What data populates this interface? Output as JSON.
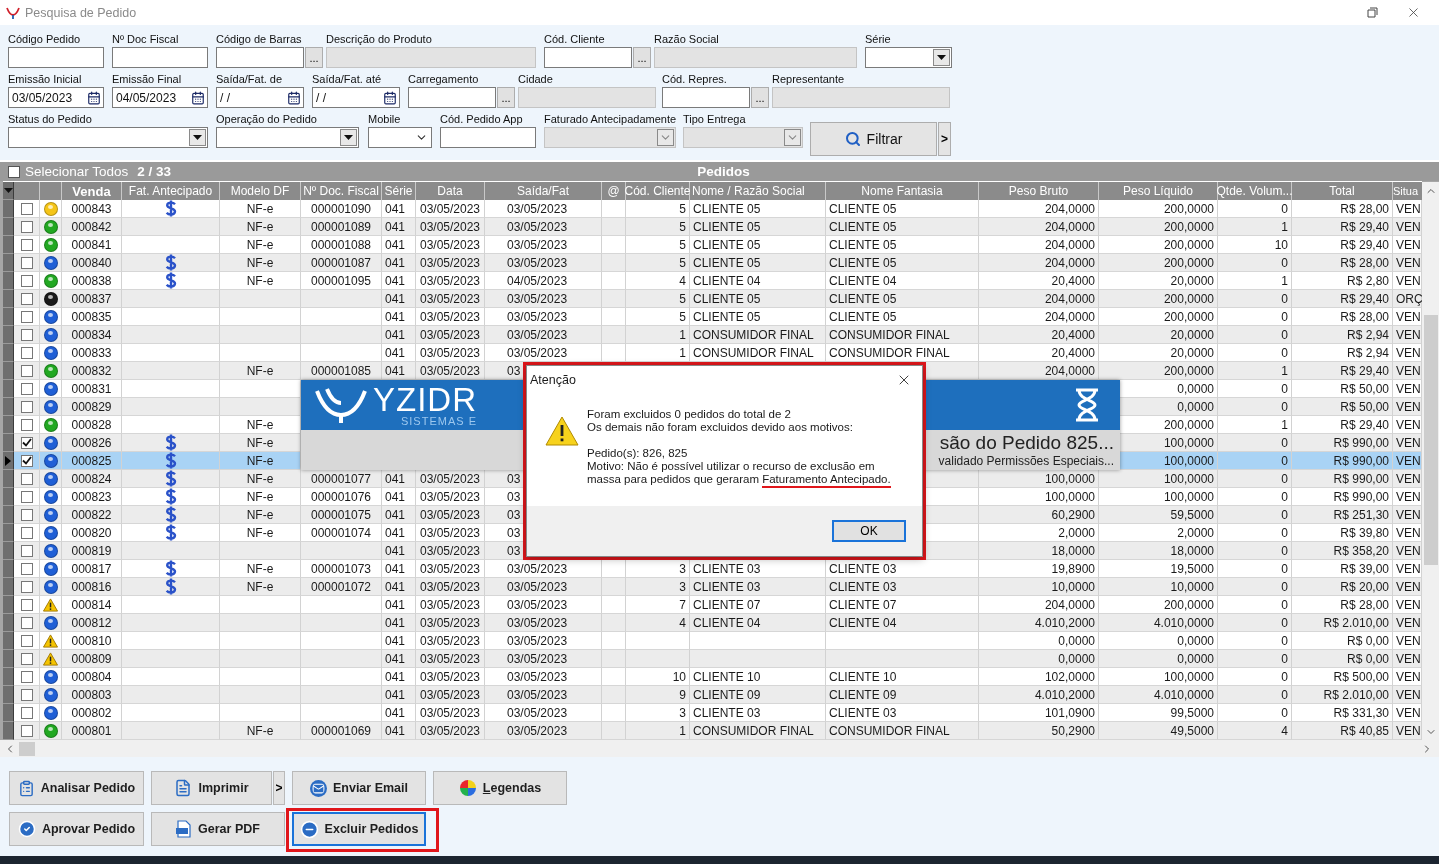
{
  "window": {
    "title": "Pesquisa de Pedido"
  },
  "filter_rows": [
    {
      "fields": [
        {
          "label": "Código Pedido",
          "kind": "text",
          "disabled": false
        },
        {
          "label": "Nº Doc Fiscal",
          "kind": "text",
          "disabled": false
        },
        {
          "label": "Código de Barras",
          "kind": "lookup",
          "button": "...",
          "disabled": false
        },
        {
          "label": "Descrição do Produto",
          "kind": "text",
          "disabled": true
        },
        {
          "label": "Cód. Cliente",
          "kind": "lookup",
          "button": "...",
          "disabled": false
        },
        {
          "label": "Razão Social",
          "kind": "text",
          "disabled": true
        },
        {
          "label": "Série",
          "kind": "select",
          "disabled": false
        }
      ]
    },
    {
      "fields": [
        {
          "label": "Emissão Inicial",
          "kind": "date",
          "value": "03/05/2023",
          "disabled": false
        },
        {
          "label": "Emissão Final",
          "kind": "date",
          "value": "04/05/2023",
          "disabled": false
        },
        {
          "label": "Saída/Fat. de",
          "kind": "date",
          "value": "/ /",
          "disabled": false
        },
        {
          "label": "Saída/Fat. até",
          "kind": "date",
          "value": "/ /",
          "disabled": false
        },
        {
          "label": "Carregamento",
          "kind": "lookup",
          "button": "...",
          "disabled": false
        },
        {
          "label": "Cidade",
          "kind": "text",
          "disabled": true
        },
        {
          "label": "Cód. Repres.",
          "kind": "lookup",
          "button": "...",
          "disabled": false
        },
        {
          "label": "Representante",
          "kind": "text",
          "disabled": true
        }
      ]
    },
    {
      "fields": [
        {
          "label": "Status do Pedido",
          "kind": "select",
          "disabled": false
        },
        {
          "label": "Operação do Pedido",
          "kind": "select",
          "disabled": false
        },
        {
          "label": "Mobile",
          "kind": "combo",
          "disabled": false
        },
        {
          "label": "Cód. Pedido App",
          "kind": "text",
          "disabled": false
        },
        {
          "label": "Faturado Antecipadamente",
          "kind": "combo",
          "disabled": true
        },
        {
          "label": "Tipo Entrega",
          "kind": "combo",
          "disabled": true
        }
      ]
    }
  ],
  "filter_button": {
    "label": "Filtrar",
    "more": ">"
  },
  "grid": {
    "select_all": {
      "label": "Selecionar Todos",
      "checked": false
    },
    "count": "2 / 33",
    "title": "Pedidos",
    "columns": [
      "Venda",
      "Fat. Antecipado",
      "Modelo DF",
      "Nº Doc. Fiscal",
      "Série",
      "Data",
      "Saída/Fat",
      "@",
      "Cód. Cliente",
      "Nome / Razão Social",
      "Nome Fantasia",
      "Peso Bruto",
      "Peso Líquido",
      "Qtde. Volum...",
      "Total",
      "Situa"
    ],
    "rows": [
      {
        "status": {
          "kind": "dot",
          "color": "#f5c518"
        },
        "checked": false,
        "selected": false,
        "fat_antecipado": true,
        "cells": {
          "venda": "000843",
          "modelo": "NF-e",
          "doc": "000001090",
          "serie": "041",
          "data": "03/05/2023",
          "saida": "03/05/2023",
          "cliente": "5",
          "nome": "CLIENTE 05",
          "fantasia": "CLIENTE 05",
          "bruto": "204,0000",
          "liquido": "200,0000",
          "volumes": "0",
          "total": "R$ 28,00",
          "situacao": "VEN"
        }
      },
      {
        "status": {
          "kind": "dot",
          "color": "#22a822"
        },
        "checked": false,
        "selected": false,
        "fat_antecipado": false,
        "cells": {
          "venda": "000842",
          "modelo": "NF-e",
          "doc": "000001089",
          "serie": "041",
          "data": "03/05/2023",
          "saida": "03/05/2023",
          "cliente": "5",
          "nome": "CLIENTE 05",
          "fantasia": "CLIENTE 05",
          "bruto": "204,0000",
          "liquido": "200,0000",
          "volumes": "1",
          "total": "R$ 29,40",
          "situacao": "VEN"
        }
      },
      {
        "status": {
          "kind": "dot",
          "color": "#22a822"
        },
        "checked": false,
        "selected": false,
        "fat_antecipado": false,
        "cells": {
          "venda": "000841",
          "modelo": "NF-e",
          "doc": "000001088",
          "serie": "041",
          "data": "03/05/2023",
          "saida": "03/05/2023",
          "cliente": "5",
          "nome": "CLIENTE 05",
          "fantasia": "CLIENTE 05",
          "bruto": "204,0000",
          "liquido": "200,0000",
          "volumes": "10",
          "total": "R$ 29,40",
          "situacao": "VEN"
        }
      },
      {
        "status": {
          "kind": "dot",
          "color": "#1f5fd6"
        },
        "checked": false,
        "selected": false,
        "fat_antecipado": true,
        "cells": {
          "venda": "000840",
          "modelo": "NF-e",
          "doc": "000001087",
          "serie": "041",
          "data": "03/05/2023",
          "saida": "03/05/2023",
          "cliente": "5",
          "nome": "CLIENTE 05",
          "fantasia": "CLIENTE 05",
          "bruto": "204,0000",
          "liquido": "200,0000",
          "volumes": "0",
          "total": "R$ 28,00",
          "situacao": "VEN"
        }
      },
      {
        "status": {
          "kind": "dot",
          "color": "#22a822"
        },
        "checked": false,
        "selected": false,
        "fat_antecipado": true,
        "cells": {
          "venda": "000838",
          "modelo": "NF-e",
          "doc": "000001095",
          "serie": "041",
          "data": "03/05/2023",
          "saida": "04/05/2023",
          "cliente": "4",
          "nome": "CLIENTE 04",
          "fantasia": "CLIENTE 04",
          "bruto": "20,4000",
          "liquido": "20,0000",
          "volumes": "1",
          "total": "R$ 2,80",
          "situacao": "VEN"
        }
      },
      {
        "status": {
          "kind": "dot",
          "color": "#1a1a1a"
        },
        "checked": false,
        "selected": false,
        "fat_antecipado": false,
        "cells": {
          "venda": "000837",
          "serie": "041",
          "data": "03/05/2023",
          "saida": "03/05/2023",
          "cliente": "5",
          "nome": "CLIENTE 05",
          "fantasia": "CLIENTE 05",
          "bruto": "204,0000",
          "liquido": "200,0000",
          "volumes": "0",
          "total": "R$ 29,40",
          "situacao": "ORÇ"
        }
      },
      {
        "status": {
          "kind": "dot",
          "color": "#1f5fd6"
        },
        "checked": false,
        "selected": false,
        "fat_antecipado": false,
        "cells": {
          "venda": "000835",
          "serie": "041",
          "data": "03/05/2023",
          "saida": "03/05/2023",
          "cliente": "5",
          "nome": "CLIENTE 05",
          "fantasia": "CLIENTE 05",
          "bruto": "204,0000",
          "liquido": "200,0000",
          "volumes": "0",
          "total": "R$ 28,00",
          "situacao": "VEN"
        }
      },
      {
        "status": {
          "kind": "dot",
          "color": "#1f5fd6"
        },
        "checked": false,
        "selected": false,
        "fat_antecipado": false,
        "cells": {
          "venda": "000834",
          "serie": "041",
          "data": "03/05/2023",
          "saida": "03/05/2023",
          "cliente": "1",
          "nome": "CONSUMIDOR FINAL",
          "fantasia": "CONSUMIDOR FINAL",
          "bruto": "20,4000",
          "liquido": "20,0000",
          "volumes": "0",
          "total": "R$ 2,94",
          "situacao": "VEN"
        }
      },
      {
        "status": {
          "kind": "dot",
          "color": "#1f5fd6"
        },
        "checked": false,
        "selected": false,
        "fat_antecipado": false,
        "cells": {
          "venda": "000833",
          "serie": "041",
          "data": "03/05/2023",
          "saida": "03/05/2023",
          "cliente": "1",
          "nome": "CONSUMIDOR FINAL",
          "fantasia": "CONSUMIDOR FINAL",
          "bruto": "20,4000",
          "liquido": "20,0000",
          "volumes": "0",
          "total": "R$ 2,94",
          "situacao": "VEN"
        }
      },
      {
        "status": {
          "kind": "dot",
          "color": "#22a822"
        },
        "checked": false,
        "selected": false,
        "fat_antecipado": false,
        "cells": {
          "venda": "000832",
          "modelo": "NF-e",
          "doc": "000001085",
          "serie": "041",
          "data": "03/05/2023",
          "saida": "03",
          "bruto": "204,0000",
          "liquido": "200,0000",
          "volumes": "1",
          "total": "R$ 29,40",
          "situacao": "VEN"
        }
      },
      {
        "status": {
          "kind": "dot",
          "color": "#1f5fd6"
        },
        "checked": false,
        "selected": false,
        "fat_antecipado": false,
        "cells": {
          "venda": "000831",
          "liquido": "0,0000",
          "volumes": "0",
          "total": "R$ 50,00",
          "situacao": "VEN"
        }
      },
      {
        "status": {
          "kind": "dot",
          "color": "#1f5fd6"
        },
        "checked": false,
        "selected": false,
        "fat_antecipado": false,
        "cells": {
          "venda": "000829",
          "liquido": "0,0000",
          "volumes": "0",
          "total": "R$ 50,00",
          "situacao": "VEN"
        }
      },
      {
        "status": {
          "kind": "dot",
          "color": "#22a822"
        },
        "checked": false,
        "selected": false,
        "fat_antecipado": false,
        "cells": {
          "venda": "000828",
          "modelo": "NF-e",
          "liquido": "200,0000",
          "volumes": "1",
          "total": "R$ 29,40",
          "situacao": "VEN"
        }
      },
      {
        "status": {
          "kind": "dot",
          "color": "#1f5fd6"
        },
        "checked": true,
        "selected": false,
        "fat_antecipado": true,
        "cells": {
          "venda": "000826",
          "modelo": "NF-e",
          "liquido": "100,0000",
          "volumes": "0",
          "total": "R$ 990,00",
          "situacao": "VEN"
        }
      },
      {
        "status": {
          "kind": "dot",
          "color": "#1f5fd6"
        },
        "checked": true,
        "selected": true,
        "fat_antecipado": true,
        "cells": {
          "venda": "000825",
          "modelo": "NF-e",
          "liquido": "100,0000",
          "volumes": "0",
          "total": "R$ 990,00",
          "situacao": "VEN"
        }
      },
      {
        "status": {
          "kind": "dot",
          "color": "#1f5fd6"
        },
        "checked": false,
        "selected": false,
        "fat_antecipado": true,
        "cells": {
          "venda": "000824",
          "modelo": "NF-e",
          "doc": "000001077",
          "serie": "041",
          "data": "03/05/2023",
          "saida": "03",
          "bruto": "100,0000",
          "liquido": "100,0000",
          "volumes": "0",
          "total": "R$ 990,00",
          "situacao": "VEN"
        }
      },
      {
        "status": {
          "kind": "dot",
          "color": "#1f5fd6"
        },
        "checked": false,
        "selected": false,
        "fat_antecipado": true,
        "cells": {
          "venda": "000823",
          "modelo": "NF-e",
          "doc": "000001076",
          "serie": "041",
          "data": "03/05/2023",
          "saida": "03",
          "bruto": "100,0000",
          "liquido": "100,0000",
          "volumes": "0",
          "total": "R$ 990,00",
          "situacao": "VEN"
        }
      },
      {
        "status": {
          "kind": "dot",
          "color": "#1f5fd6"
        },
        "checked": false,
        "selected": false,
        "fat_antecipado": true,
        "cells": {
          "venda": "000822",
          "modelo": "NF-e",
          "doc": "000001075",
          "serie": "041",
          "data": "03/05/2023",
          "saida": "03",
          "bruto": "60,2900",
          "liquido": "59,5000",
          "volumes": "0",
          "total": "R$ 251,30",
          "situacao": "VEN"
        }
      },
      {
        "status": {
          "kind": "dot",
          "color": "#1f5fd6"
        },
        "checked": false,
        "selected": false,
        "fat_antecipado": true,
        "cells": {
          "venda": "000820",
          "modelo": "NF-e",
          "doc": "000001074",
          "serie": "041",
          "data": "03/05/2023",
          "saida": "03",
          "bruto": "2,0000",
          "liquido": "2,0000",
          "volumes": "0",
          "total": "R$ 39,80",
          "situacao": "VEN"
        }
      },
      {
        "status": {
          "kind": "dot",
          "color": "#1f5fd6"
        },
        "checked": false,
        "selected": false,
        "fat_antecipado": false,
        "cells": {
          "venda": "000819",
          "serie": "041",
          "data": "03/05/2023",
          "saida": "03",
          "bruto": "18,0000",
          "liquido": "18,0000",
          "volumes": "0",
          "total": "R$ 358,20",
          "situacao": "VEN"
        }
      },
      {
        "status": {
          "kind": "dot",
          "color": "#1f5fd6"
        },
        "checked": false,
        "selected": false,
        "fat_antecipado": true,
        "cells": {
          "venda": "000817",
          "modelo": "NF-e",
          "doc": "000001073",
          "serie": "041",
          "data": "03/05/2023",
          "saida": "03/05/2023",
          "cliente": "3",
          "nome": "CLIENTE 03",
          "fantasia": "CLIENTE 03",
          "bruto": "19,8900",
          "liquido": "19,5000",
          "volumes": "0",
          "total": "R$ 39,00",
          "situacao": "VEN"
        }
      },
      {
        "status": {
          "kind": "dot",
          "color": "#1f5fd6"
        },
        "checked": false,
        "selected": false,
        "fat_antecipado": true,
        "cells": {
          "venda": "000816",
          "modelo": "NF-e",
          "doc": "000001072",
          "serie": "041",
          "data": "03/05/2023",
          "saida": "03/05/2023",
          "cliente": "3",
          "nome": "CLIENTE 03",
          "fantasia": "CLIENTE 03",
          "bruto": "10,0000",
          "liquido": "10,0000",
          "volumes": "0",
          "total": "R$ 20,00",
          "situacao": "VEN"
        }
      },
      {
        "status": {
          "kind": "warning"
        },
        "checked": false,
        "selected": false,
        "fat_antecipado": false,
        "cells": {
          "venda": "000814",
          "serie": "041",
          "data": "03/05/2023",
          "saida": "03/05/2023",
          "cliente": "7",
          "nome": "CLIENTE 07",
          "fantasia": "CLIENTE 07",
          "bruto": "204,0000",
          "liquido": "200,0000",
          "volumes": "0",
          "total": "R$ 28,00",
          "situacao": "VEN"
        }
      },
      {
        "status": {
          "kind": "dot",
          "color": "#1f5fd6"
        },
        "checked": false,
        "selected": false,
        "fat_antecipado": false,
        "cells": {
          "venda": "000812",
          "serie": "041",
          "data": "03/05/2023",
          "saida": "03/05/2023",
          "cliente": "4",
          "nome": "CLIENTE 04",
          "fantasia": "CLIENTE 04",
          "bruto": "4.010,2000",
          "liquido": "4.010,0000",
          "volumes": "0",
          "total": "R$ 2.010,00",
          "situacao": "VEN"
        }
      },
      {
        "status": {
          "kind": "warning"
        },
        "checked": false,
        "selected": false,
        "fat_antecipado": false,
        "cells": {
          "venda": "000810",
          "serie": "041",
          "data": "03/05/2023",
          "saida": "03/05/2023",
          "bruto": "0,0000",
          "liquido": "0,0000",
          "volumes": "0",
          "total": "R$ 0,00",
          "situacao": "VEN"
        }
      },
      {
        "status": {
          "kind": "warning"
        },
        "checked": false,
        "selected": false,
        "fat_antecipado": false,
        "cells": {
          "venda": "000809",
          "serie": "041",
          "data": "03/05/2023",
          "saida": "03/05/2023",
          "bruto": "0,0000",
          "liquido": "0,0000",
          "volumes": "0",
          "total": "R$ 0,00",
          "situacao": "VEN"
        }
      },
      {
        "status": {
          "kind": "dot",
          "color": "#1f5fd6"
        },
        "checked": false,
        "selected": false,
        "fat_antecipado": false,
        "cells": {
          "venda": "000804",
          "serie": "041",
          "data": "03/05/2023",
          "saida": "03/05/2023",
          "cliente": "10",
          "nome": "CLIENTE 10",
          "fantasia": "CLIENTE 10",
          "bruto": "102,0000",
          "liquido": "100,0000",
          "volumes": "0",
          "total": "R$ 500,00",
          "situacao": "VEN"
        }
      },
      {
        "status": {
          "kind": "dot",
          "color": "#1f5fd6"
        },
        "checked": false,
        "selected": false,
        "fat_antecipado": false,
        "cells": {
          "venda": "000803",
          "serie": "041",
          "data": "03/05/2023",
          "saida": "03/05/2023",
          "cliente": "9",
          "nome": "CLIENTE 09",
          "fantasia": "CLIENTE 09",
          "bruto": "4.010,2000",
          "liquido": "4.010,0000",
          "volumes": "0",
          "total": "R$ 2.010,00",
          "situacao": "VEN"
        }
      },
      {
        "status": {
          "kind": "dot",
          "color": "#1f5fd6"
        },
        "checked": false,
        "selected": false,
        "fat_antecipado": false,
        "cells": {
          "venda": "000802",
          "serie": "041",
          "data": "03/05/2023",
          "saida": "03/05/2023",
          "cliente": "3",
          "nome": "CLIENTE 03",
          "fantasia": "CLIENTE 03",
          "bruto": "101,0900",
          "liquido": "99,5000",
          "volumes": "0",
          "total": "R$ 331,30",
          "situacao": "VEN"
        }
      },
      {
        "status": {
          "kind": "dot",
          "color": "#22a822"
        },
        "checked": false,
        "selected": false,
        "fat_antecipado": false,
        "cells": {
          "venda": "000801",
          "modelo": "NF-e",
          "doc": "000001069",
          "serie": "041",
          "data": "03/05/2023",
          "saida": "03/05/2023",
          "cliente": "1",
          "nome": "CONSUMIDOR FINAL",
          "fantasia": "CONSUMIDOR FINAL",
          "bruto": "50,2900",
          "liquido": "49,5000",
          "volumes": "4",
          "total": "R$ 40,85",
          "situacao": "VEN"
        }
      }
    ]
  },
  "action_rows": [
    {
      "buttons": [
        {
          "kind": "analyze",
          "label": "Analisar Pedido",
          "highlighted": false
        },
        {
          "kind": "print",
          "label": "Imprimir",
          "menu": ">",
          "highlighted": false
        },
        {
          "kind": "email",
          "label": "Enviar Email",
          "highlighted": false
        },
        {
          "kind": "legend",
          "label": "Legendas",
          "highlighted": false
        }
      ]
    },
    {
      "buttons": [
        {
          "kind": "approve",
          "label": "Aprovar Pedido",
          "highlighted": false
        },
        {
          "kind": "pdf",
          "label": "Gerar PDF",
          "highlighted": false
        },
        {
          "kind": "delete",
          "label": "Excluir Pedidos",
          "highlighted": true
        }
      ]
    }
  ],
  "loading_window": {
    "brand": "YZIDR",
    "tagline": "SISTEMAS E",
    "message": "são do Pedido 825...",
    "detail": "validado Permissões Especiais..."
  },
  "dialog": {
    "title": "Atenção",
    "lines": [
      "Foram excluidos 0 pedidos do total de 2",
      "Os demais não foram excluidos devido aos motivos:"
    ],
    "orders": "Pedido(s): 826, 825",
    "reason": "Motivo: Não é possível utilizar o recurso de exclusão em massa para pedidos que geraram",
    "reason_marked": "Faturamento Antecipado.",
    "button": "OK"
  }
}
